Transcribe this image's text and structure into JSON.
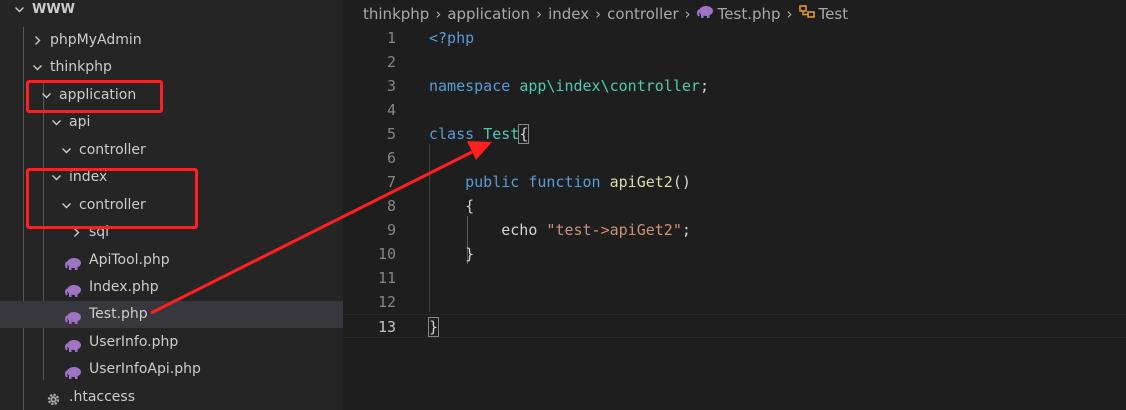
{
  "sidebar": {
    "items": [
      {
        "label": "WWW",
        "type": "folder-open"
      },
      {
        "label": "phpMyAdmin",
        "type": "folder-closed"
      },
      {
        "label": "thinkphp",
        "type": "folder-open"
      },
      {
        "label": "application",
        "type": "folder-open"
      },
      {
        "label": "api",
        "type": "folder-open"
      },
      {
        "label": "controller",
        "type": "folder-open"
      },
      {
        "label": "index",
        "type": "folder-open"
      },
      {
        "label": "controller",
        "type": "folder-open"
      },
      {
        "label": "sql",
        "type": "folder-closed"
      },
      {
        "label": "ApiTool.php",
        "type": "php-file"
      },
      {
        "label": "Index.php",
        "type": "php-file"
      },
      {
        "label": "Test.php",
        "type": "php-file",
        "selected": true
      },
      {
        "label": "UserInfo.php",
        "type": "php-file"
      },
      {
        "label": "UserInfoApi.php",
        "type": "php-file"
      },
      {
        "label": ".htaccess",
        "type": "config-file"
      }
    ]
  },
  "breadcrumb": {
    "parts": [
      "thinkphp",
      "application",
      "index",
      "controller",
      "Test.php",
      "Test"
    ],
    "file_icon": "php-elephant-icon",
    "symbol_icon": "class-symbol-icon"
  },
  "editor": {
    "current_line": 13,
    "lines": [
      {
        "n": "1",
        "tokens": [
          [
            "kw",
            "<?php"
          ]
        ]
      },
      {
        "n": "2",
        "tokens": []
      },
      {
        "n": "3",
        "tokens": [
          [
            "kw",
            "namespace "
          ],
          [
            "ns",
            "app\\index\\controller"
          ],
          [
            "txt",
            ";"
          ]
        ]
      },
      {
        "n": "4",
        "tokens": []
      },
      {
        "n": "5",
        "tokens": [
          [
            "kw",
            "class "
          ],
          [
            "cls",
            "Test"
          ],
          [
            "bracket",
            "{"
          ]
        ]
      },
      {
        "n": "6",
        "tokens": []
      },
      {
        "n": "7",
        "tokens": [
          [
            "txt",
            "    "
          ],
          [
            "kw",
            "public "
          ],
          [
            "kw",
            "function "
          ],
          [
            "fn",
            "apiGet2"
          ],
          [
            "txt",
            "()"
          ]
        ]
      },
      {
        "n": "8",
        "tokens": [
          [
            "txt",
            "    {"
          ]
        ]
      },
      {
        "n": "9",
        "tokens": [
          [
            "txt",
            "        "
          ],
          [
            "echo",
            "echo "
          ],
          [
            "str",
            "\"test->apiGet2\""
          ],
          [
            "txt",
            ";"
          ]
        ]
      },
      {
        "n": "10",
        "tokens": [
          [
            "txt",
            "    }"
          ]
        ]
      },
      {
        "n": "11",
        "tokens": []
      },
      {
        "n": "12",
        "tokens": []
      },
      {
        "n": "13",
        "tokens": [
          [
            "bracket",
            "}"
          ]
        ]
      }
    ]
  },
  "colors": {
    "annotation": "#ff1f1f",
    "php_icon": "#a074c4",
    "class_icon": "#ee9d28"
  }
}
